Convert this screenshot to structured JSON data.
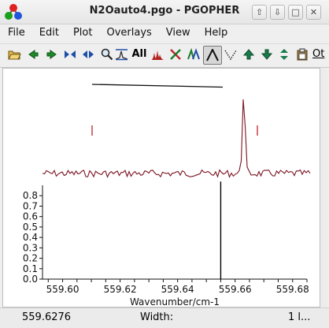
{
  "window": {
    "title": "N2Oauto4.pgo - PGOPHER",
    "controls": [
      "up",
      "down",
      "restore",
      "close"
    ]
  },
  "menu": [
    "File",
    "Edit",
    "Plot",
    "Overlays",
    "View",
    "Help"
  ],
  "toolbar": {
    "icons": [
      "open-icon",
      "arrow-left-icon",
      "arrow-right-icon",
      "zoom-in-x-icon",
      "zoom-out-x-icon",
      "zoom-icon",
      "peak-find-icon",
      "all-label",
      "bars-icon",
      "cross-icon",
      "lines-icon",
      "peak-shape-icon",
      "dotted-icon",
      "shift-up-icon",
      "shift-down-icon",
      "expand-vertical-icon",
      "clipboard-icon"
    ],
    "all_label": "All",
    "overflow_label": "Ot"
  },
  "colors": {
    "spectrum": "#7a1320",
    "simulation": "#000000",
    "accent_red": "#c0222a"
  },
  "chart_data": {
    "type": "line",
    "xlabel": "Wavenumber/cm-1",
    "xlim": [
      559.593,
      559.685
    ],
    "x_ticks": [
      "559.60",
      "559.62",
      "559.64",
      "559.66",
      "559.68"
    ],
    "ylim": [
      0,
      0.9
    ],
    "y_ticks": [
      "0.0",
      "0.1",
      "0.2",
      "0.3",
      "0.4",
      "0.5",
      "0.6",
      "0.7",
      "0.8"
    ],
    "simulated_lines": [
      {
        "x": 559.655,
        "y": 1.0
      }
    ],
    "observed_peak": {
      "x": 559.663
    }
  },
  "status": {
    "cursor": "559.6276",
    "width_label": "Width:",
    "right": "1 l..."
  }
}
